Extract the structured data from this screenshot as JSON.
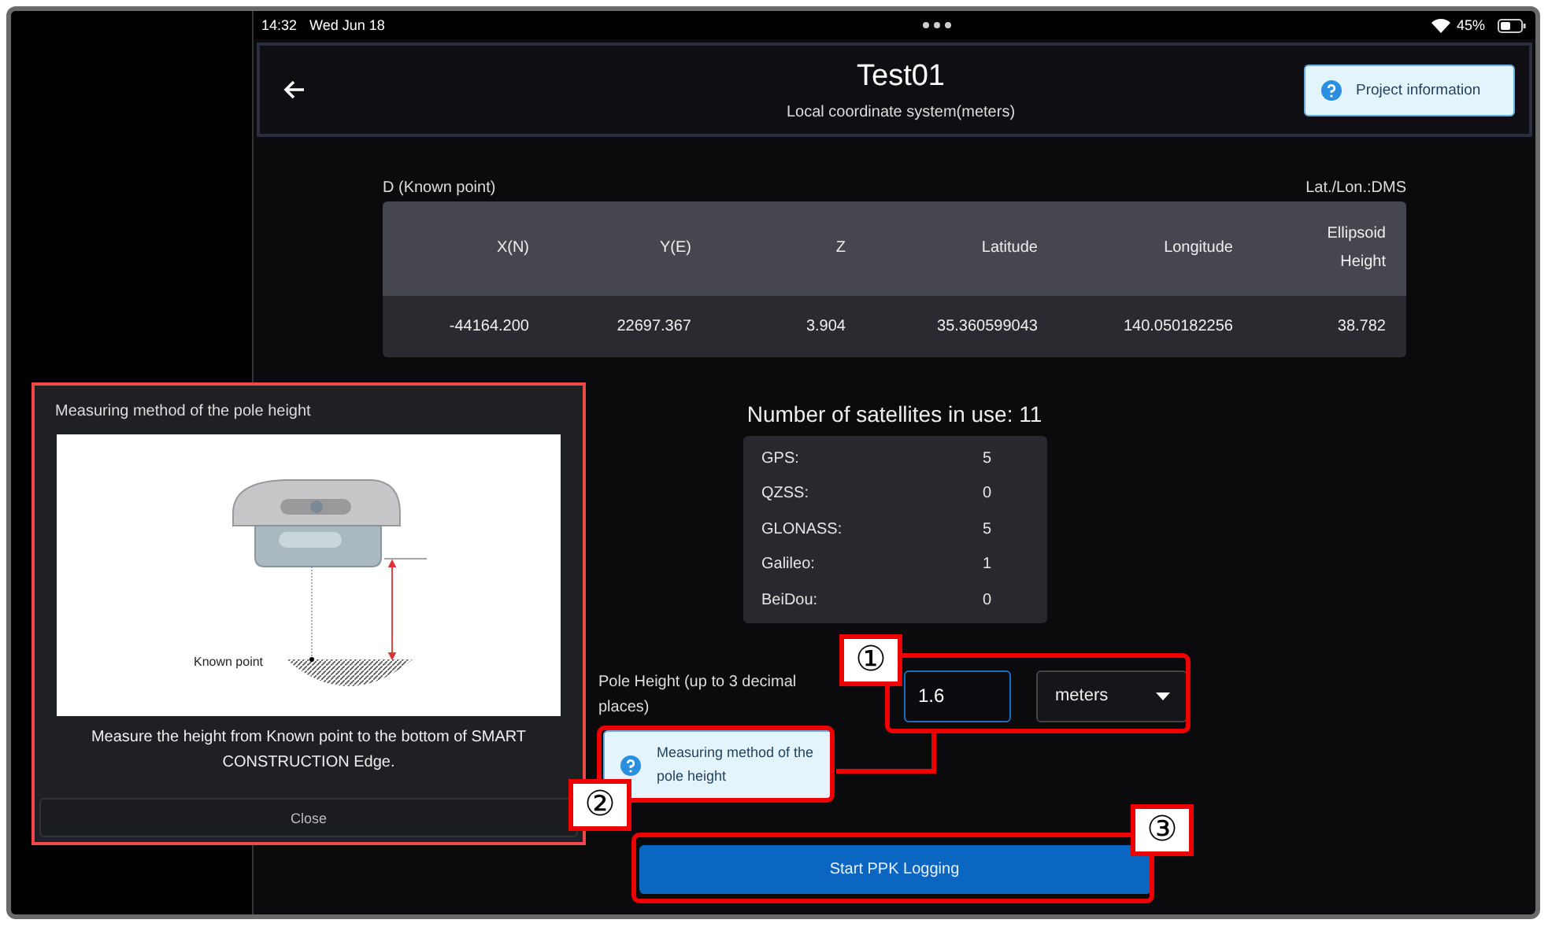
{
  "status_bar": {
    "time": "14:32",
    "date": "Wed Jun 18",
    "battery": "45%"
  },
  "header": {
    "title": "Test01",
    "subtitle": "Local coordinate system(meters)",
    "info_button": "Project information"
  },
  "point": {
    "label": "D (Known point)",
    "format": "Lat./Lon.:DMS",
    "columns": [
      "X(N)",
      "Y(E)",
      "Z",
      "Latitude",
      "Longitude",
      "Ellipsoid Height"
    ],
    "values": [
      "-44164.200",
      "22697.367",
      "3.904",
      "35.360599043",
      "140.050182256",
      "38.782"
    ]
  },
  "satellites": {
    "title": "Number of satellites in use: 11",
    "rows": [
      {
        "name": "GPS:",
        "count": "5"
      },
      {
        "name": "QZSS:",
        "count": "0"
      },
      {
        "name": "GLONASS:",
        "count": "5"
      },
      {
        "name": "Galileo:",
        "count": "1"
      },
      {
        "name": "BeiDou:",
        "count": "0"
      }
    ]
  },
  "pole_height": {
    "label": "Pole Height (up to 3 decimal places)",
    "value": "1.6",
    "unit": "meters",
    "help_button": "Measuring method of the pole height"
  },
  "start_button": "Start PPK Logging",
  "popup": {
    "title": "Measuring method of the pole height",
    "diagram_label": "Known point",
    "description": "Measure the height from Known point to the bottom of SMART CONSTRUCTION Edge.",
    "close": "Close"
  },
  "annotations": [
    {
      "label": "①"
    },
    {
      "label": "②"
    },
    {
      "label": "③"
    }
  ]
}
